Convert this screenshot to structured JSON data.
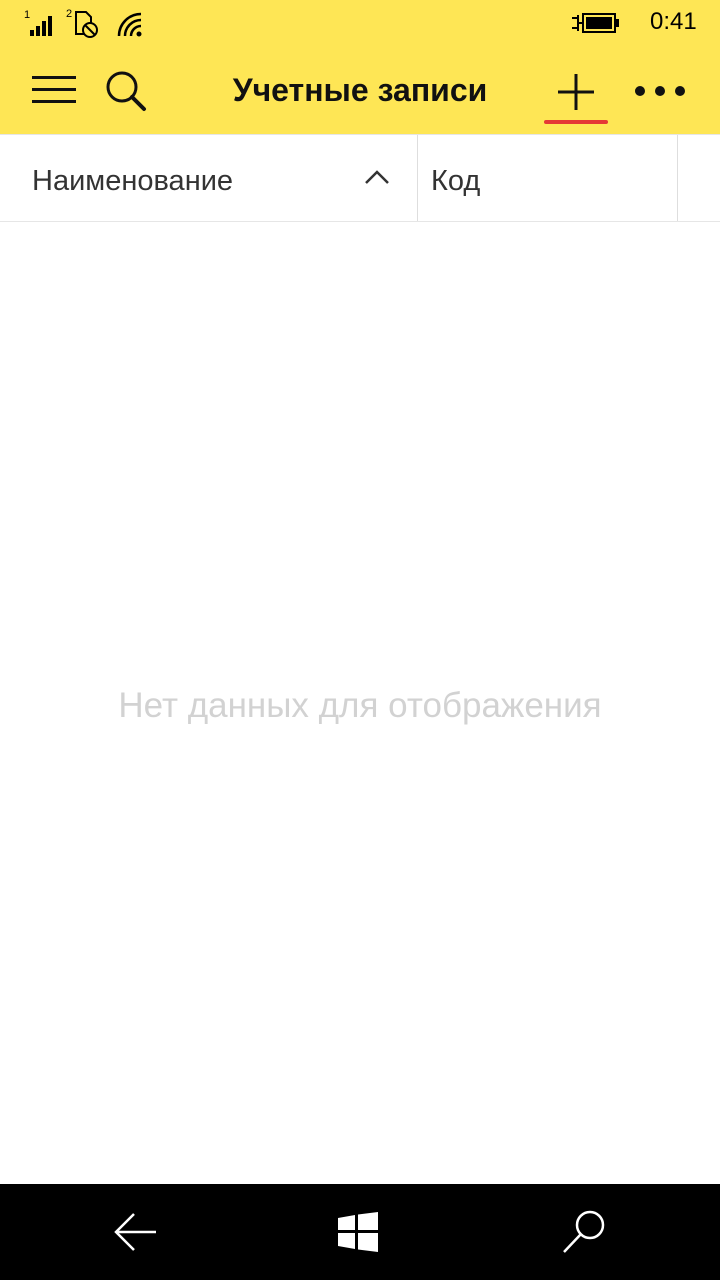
{
  "status_bar": {
    "time": "0:41",
    "signal_1_label": "1",
    "signal_2_label": "2",
    "icons": [
      "signal-strength-icon",
      "sim-no-signal-icon",
      "wifi-icon",
      "battery-charging-icon"
    ]
  },
  "app_bar": {
    "title": "Учетные записи",
    "icons": [
      "hamburger-menu-icon",
      "search-icon",
      "add-icon",
      "more-options-icon"
    ]
  },
  "table": {
    "columns": [
      {
        "label": "Наименование",
        "sort": "ascending"
      },
      {
        "label": "Код"
      }
    ],
    "empty_text": "Нет данных для отображения"
  },
  "nav_bar": {
    "icons": [
      "back-arrow-icon",
      "windows-start-icon",
      "search-icon"
    ]
  },
  "colors": {
    "header_bg": "#fee655",
    "active_underline": "#e53935",
    "nav_bg": "#000000",
    "empty_text": "#d2d2d2"
  }
}
